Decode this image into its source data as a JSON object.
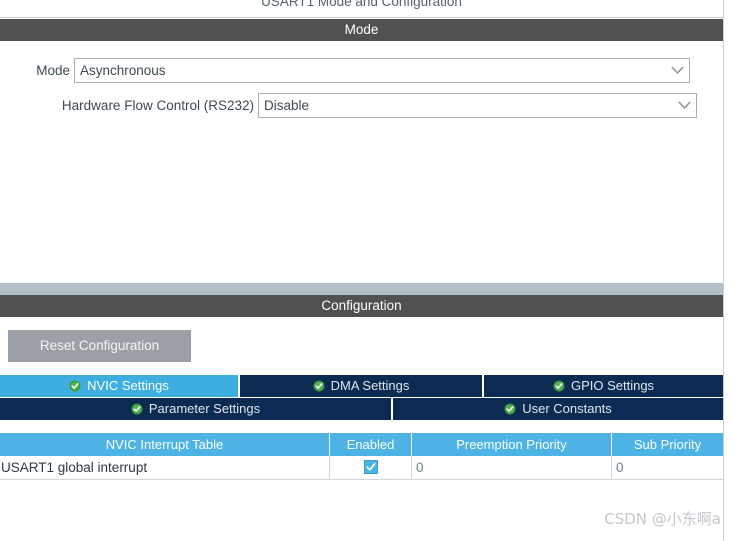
{
  "window": {
    "title": "USART1 Mode and Configuration"
  },
  "sections": {
    "mode_bar": "Mode",
    "configuration_bar": "Configuration"
  },
  "mode_panel": {
    "rows": [
      {
        "label": "Mode",
        "value": "Asynchronous",
        "arrow_icon": "chevron-down-icon"
      },
      {
        "label": "Hardware Flow Control (RS232)",
        "value": "Disable",
        "arrow_icon": "chevron-down-icon"
      }
    ]
  },
  "configuration_panel": {
    "reset_button": "Reset Configuration",
    "tabs_row1": [
      {
        "label": "NVIC Settings",
        "active": true,
        "status_icon": "green-check-circle-icon"
      },
      {
        "label": "DMA Settings",
        "active": false,
        "status_icon": "green-check-circle-icon"
      },
      {
        "label": "GPIO Settings",
        "active": false,
        "status_icon": "green-check-circle-icon"
      }
    ],
    "tabs_row2": [
      {
        "label": "Parameter Settings",
        "active": false,
        "status_icon": "green-check-circle-icon"
      },
      {
        "label": "User Constants",
        "active": false,
        "status_icon": "green-check-circle-icon"
      }
    ],
    "nvic_table": {
      "columns": [
        "NVIC Interrupt Table",
        "Enabled",
        "Preemption Priority",
        "Sub Priority"
      ],
      "rows": [
        {
          "name": "USART1 global interrupt",
          "enabled": true,
          "enabled_icon": "checkbox-checked-icon",
          "preemption_priority": "0",
          "sub_priority": "0"
        }
      ]
    }
  },
  "watermark": "CSDN @小东啊a",
  "colors": {
    "section_bar": "#4f5250",
    "tab_active": "#3eaee0",
    "tab_inactive": "#0c2b52",
    "table_header": "#4cb3e4",
    "separator_band": "#b3c0c8",
    "button_disabled": "#9aa0a6",
    "status_check_green": "#3a9a3a"
  }
}
